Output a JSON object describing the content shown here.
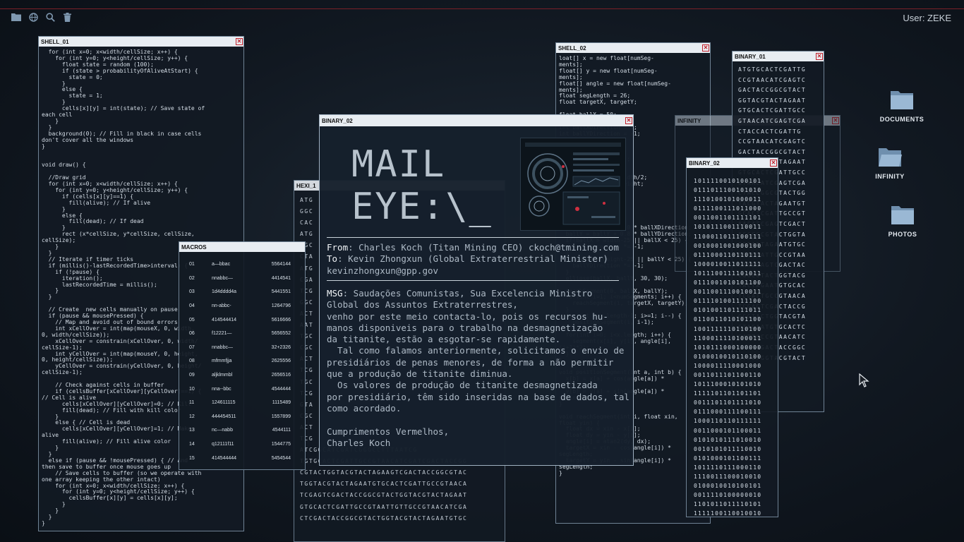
{
  "topbar": {
    "icons": [
      "folder-icon",
      "globe-icon",
      "search-icon",
      "trash-icon"
    ],
    "user_label": "User: ZEKE"
  },
  "colors": {
    "accent_red": "#c0202a",
    "window_header": "#e8edf2",
    "window_bg": "#121a24",
    "folder": "#8fb0cf"
  },
  "windows": {
    "shell01": {
      "title": "SHELL_01",
      "code": "  for (int x=0; x<width/cellSize; x++) {\n    for (int y=0; y<height/cellSize; y++) {\n      float state = random (100);\n      if (state > probabilityOfAliveAtStart) {\n        state = 0;\n      }\n      else {\n        state = 1;\n      }\n      cells[x][y] = int(state); // Save state of\neach cell\n    }\n  }\n  background(0); // Fill in black in case cells\ndon't cover all the windows\n}\n\n\nvoid draw() {\n\n  //Draw grid\n  for (int x=0; x<width/cellSize; x++) {\n    for (int y=0; y<height/cellSize; y++) {\n      if (cells[x][y]==1) {\n        fill(alive); // If alive\n      }\n      else {\n        fill(dead); // If dead\n      }\n      rect (x*cellSize, y*cellSize, cellSize,\ncellSize);\n    }\n  }\n  // Iterate if timer ticks\n  if (millis()-lastRecordedTime>interval) {\n    if (!pause) {\n      iteration();\n      lastRecordedTime = millis();\n    }\n  }\n\n  // Create  new cells manually on pause\n  if (pause && mousePressed) {\n    // Map and avoid out of bound errors\n    int xCellOver = int(map(mouseX, 0, width,\n0, width/cellSize));\n    xCellOver = constrain(xCellOver, 0, width/\ncellSize-1);\n    int yCellOver = int(map(mouseY, 0, height,\n0, height/cellSize));\n    yCellOver = constrain(yCellOver, 0, height/\ncellSize-1);\n\n    // Check against cells in buffer\n    if (cellsBuffer[xCellOver][yCellOver]==1) {\n// Cell is alive\n      cells[xCellOver][yCellOver]=0; // Kill\n      fill(dead); // Fill with kill color\n    }\n    else { // Cell is dead\n      cells[xCellOver][yCellOver]=1; // Make\nalive\n      fill(alive); // Fill alive color\n    }\n  }\n  else if (pause && !mousePressed) { // And\nthen save to buffer once mouse goes up\n    // Save cells to buffer (so we operate with\none array keeping the other intact)\n    for (int x=0; x<width/cellSize; x++) {\n      for (int y=0; y<height/cellSize; y++) {\n        cellsBuffer[x][y] = cells[x][y];\n      }\n    }\n  }\n}"
    },
    "hexi1": {
      "title": "HEXI_1",
      "code": "ATG\nGGC\nCAC\nATG\nGGC\nCTA\nATG\nCGA\nTCG\nGGC\nACT\nAAT\nTGC\nCGC\nACT\nTCG\nTGC\nTCG\nGTA\nCGC\nACT\nTCG\nATCGGCATCGATCGGGCCTTTAATCG\nTGTGCACTCGATTGCCGTAACATCGATCGACTACCGG\nCGTACTGGTACGTACTAGAAGTCGACTACCGGCGTAC\nTGGTACGTACTAGAATGTGCACTCGATTGCCGTAACA\nTCGAGTCGACTACCGGCGTACTGGTACGTACTAGAAT\nGTGCACTCGATTGCCGTAATTGTTGCCGTAACATCGA\nCTCGACTACCGGCGTACTGGTACGTACTAGAATGTGC"
    },
    "shell02": {
      "title": "SHELL_02",
      "code": "loat[] x = new float[numSeg-\nments];\nfloat[] y = new float[numSeg-\nments];\nfloat[] angle = new float[numSeg-\nments];\nfloat segLength = 26;\nfloat targetX, targetY;\n\nfloat ballX = 50;\nfloat ballY = 50;\nint ballXDirection = 1;\nint ballYDirection = -1;\n\nvoid setup() {\n  size(640, 360);\n  strokeWeight(20.0);\n  stroke(255, 100);\n  noFill();\n  x[x.length-1] = width/2;\n  y[x.length-1] = height;\n}\n\nvoid draw() {\n  background(0);\n\n  strokeWeight(20);\n  ballX = ballX + 1.0 * ballXDirection;\n  ballY = ballY + 0.8 * ballYDirection;\n  if(ballX > width-25 || ballX < 25) {\n    ballXDirection *= -1;\n  }\n  if(ballY > height-25 || ballY < 25) {\n    ballYDirection *= -1;\n  }\n  ellipse(ballX, ballY, 30, 30);\n\n  reachSegment(0, ballX, ballY);\n  for(int i=1; i<numSegments; i++) {\n    reachSegment(i, targetX, targetY);\n  }\n  for(int i=x.length-1; i>=1; i--) {\n    positionSegment(i, i-1);\n  }\n  for(int i=0; i<x.length; i++) {\n    segment(x[i], y[i], angle[i],\n(i+1)*2);\n  }\n}\n\nvoid positionSegment(int a, int b) {\n  x[b] = x[a] + cos(angle[a]) *\nsegLength;\n  y[b] = y[a] + sin(angle[a]) *\nsegLength;\n}\n\nvoid reachSegment(int i, float xin,\nfloat yin) {\n  float dx = xin - x[i];\n  float dy = yin - y[i];\n  angle[i] = atan2(dy, dx);\n  targetX = xin - cos(angle[i]) *\nsegLength;\n  targetY = yin - sin(angle[i]) *\nsegLength;\n}"
    },
    "infinity": {
      "title": "INFINITY"
    },
    "binary01": {
      "title": "BINARY_01",
      "code": "ATGTGCACTCGATTG\nCCGTAACATCGAGTC\nGACTACCGGCGTACT\nGGTACGTACTAGAAT\nGTGCACTCGATTGCC\nGTAACATCGAGTCGA\nCTACCACTCGATTG\nCCGTAACATCGAGTC\nGACTACCGGCGTACT\nGGTACGTACTAGAAT\nGTGCACTCGATTGCC\nGTAACATCGAGTCGA\nCTACCGGCGTACTGG\nTACGTACTAGAATGT\nGCACTCGATTGCCGT\nAACATCGAGTCGACT\nACCGGCGTACTGGTA\nCGTACTAGAATGTGC\nACTCGATTGCCGTAA\nCATCGAGTCGACTAC\nCGGCGTACTGGTACG\nTACTAGAATGTGCAC\nTCGATTGCCGTAACA\nTCGAGTCGACTACCG\nGCGTACTGGTACGTA\nCTAGAATGTGCACTC\nGATTGCCGTAACATC\nGAGTCGACTACCGGC\nGTACTGGTACGTACT"
    },
    "binary02_side": {
      "title": "BINARY_02",
      "code": "1011110010100101\n0111011100101010\n1110100101000011\n0111100111011000\n0011001101111101\n1010111001110011\n1100011011100111\n0010001001000100\n0111000110110111\n1000010011011111\n1011100111101011\n0111001010101100\n0011001110010011\n0111101001111100\n0101001101111011\n0110011010101100\n1001111110110100\n1100011110100011\n1010111000100000\n0100010010110100\n1000011110001000\n0011011101100110\n1011100010101010\n1111101101101101\n0011101101111010\n0111000111100111\n1000110110111111\n0011000101100011\n0101010111010010\n0010101011110010\n0101000101100111\n1011110111000110\n1110011100010010\n0100010010100101\n0011110100000010\n1101011011110101\n1111100110010010\n1101110110110010"
    },
    "macros": {
      "title": "MACROS",
      "rows": [
        {
          "id": "01",
          "name": "a—bbac",
          "value": "5564144"
        },
        {
          "id": "02",
          "name": "nnabbc—",
          "value": "4414541"
        },
        {
          "id": "03",
          "name": "1d4dddd4a",
          "value": "5441551"
        },
        {
          "id": "04",
          "name": "nn-abbc-",
          "value": "1264796"
        },
        {
          "id": "05",
          "name": "414544414",
          "value": "5616666"
        },
        {
          "id": "06",
          "name": "f12221—",
          "value": "5656552"
        },
        {
          "id": "07",
          "name": "nnabbc—",
          "value": "32+2326"
        },
        {
          "id": "08",
          "name": "mfmmfjja",
          "value": "2625556"
        },
        {
          "id": "09",
          "name": "aljklmmbl",
          "value": "2656516"
        },
        {
          "id": "10",
          "name": "nna--bbc",
          "value": "4544444"
        },
        {
          "id": "11",
          "name": "124611115",
          "value": "1115489"
        },
        {
          "id": "12",
          "name": "444454511",
          "value": "1557899"
        },
        {
          "id": "13",
          "name": "nc—nabb",
          "value": "4544111"
        },
        {
          "id": "14",
          "name": "q12111f11",
          "value": "1544775"
        },
        {
          "id": "15",
          "name": "414544444",
          "value": "5454544"
        }
      ]
    },
    "mail": {
      "title": "BINARY_02",
      "logo_line1": "MAIL",
      "logo_line2": "EYE:\\_",
      "from_label": "From",
      "from_value": ": Charles Koch (Titan Mining CEO) ckoch@tmining.com",
      "to_label": "To",
      "to_value": ": Kevin Zhongxun (Global Extraterrestrial Minister)",
      "to_email": "kevinzhongxun@gpp.gov",
      "msg_label": "MSG",
      "msg_first": ": Saudações Comunistas, Sua Excelencia Ministro",
      "msg_body": "Global dos Assuntos Extraterrestres,\nvenho por este meio contacta-lo, pois os recursos hu-\nmanos disponiveis para o trabalho na desmagnetização\nda titanite, estão a esgotar-se rapidamente.\n  Tal como falamos anteriormente, solicitamos o envio de\npresidiários de penas menores, de forma a não permitir\nque a produção de titanite diminua.\n  Os valores de produção de titanite desmagnetizada\npor presidiário, têm sido inseridas na base de dados, tal\ncomo acordado.\n\nCumprimentos Vermelhos,\nCharles Koch"
    }
  },
  "desktop": {
    "icons": [
      {
        "label": "DOCUMENTS",
        "icon": "folder-icon"
      },
      {
        "label": "INFINITY",
        "icon": "folder-open-icon"
      },
      {
        "label": "PHOTOS",
        "icon": "folder-icon"
      }
    ]
  }
}
